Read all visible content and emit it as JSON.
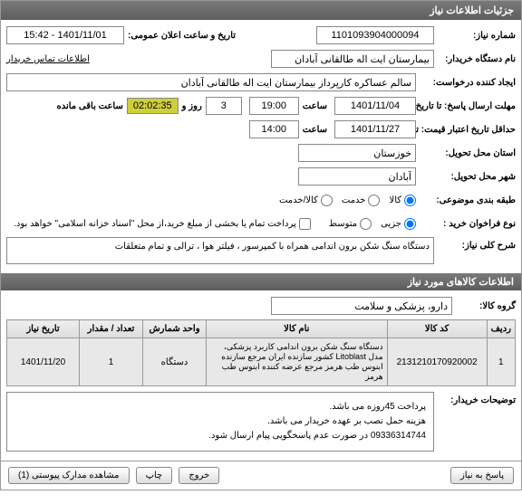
{
  "header": {
    "title": "جزئیات اطلاعات نیاز"
  },
  "fields": {
    "need_number": {
      "label": "شماره نیاز:",
      "value": "1101093904000094"
    },
    "announce": {
      "label": "تاریخ و ساعت اعلان عمومی:",
      "value": "1401/11/01 - 15:42"
    },
    "buyer_name": {
      "label": "نام دستگاه خریدار:",
      "value": "بیمارستان ایت اله طالقانی آبادان"
    },
    "buyer_contact_link": "اطلاعات تماس خریدار",
    "request_creator": {
      "label": "ایجاد کننده درخواست:",
      "value": "سالم عساکره کارپرداز بیمارستان ایت اله طالقانی آبادان"
    },
    "deadline": {
      "label": "مهلت ارسال پاسخ: تا تاریخ:",
      "date": "1401/11/04",
      "time_label": "ساعت",
      "time": "19:00",
      "days": "3",
      "days_label": "روز و",
      "timer": "02:02:35",
      "remaining": "ساعت باقی مانده"
    },
    "validity": {
      "label": "حداقل تاریخ اعتبار قیمت: تا",
      "date": "1401/11/27",
      "time_label": "ساعت",
      "time": "14:00"
    },
    "delivery_province": {
      "label": "استان محل تحویل:",
      "value": "خوزستان"
    },
    "delivery_city": {
      "label": "شهر محل تحویل:",
      "value": "آبادان"
    },
    "category": {
      "label": "طبقه بندی موضوعی:",
      "opts": [
        "کالا",
        "خدمت",
        "کالا/خدمت"
      ]
    },
    "purchase_type": {
      "label": "نوع فراخوان خرید :",
      "opts": [
        "جزیی",
        "متوسط",
        "پرداخت تمام یا بخشی از مبلغ خرید،از محل \"اسناد خزانه اسلامی\" خواهد بود."
      ]
    },
    "desc": {
      "label": "شرح کلی نیاز:",
      "value": "دستگاه سنگ شکن برون اندامی همراه با کمپرسور ، فیلتر هوا ، ترالی و تمام متعلقات"
    },
    "goods_section": "اطلاعات کالاهای مورد نیاز",
    "goods_group": {
      "label": "گروه کالا:",
      "value": "دارو، پزشکی و سلامت"
    }
  },
  "table": {
    "headers": [
      "ردیف",
      "کد کالا",
      "نام کالا",
      "واحد شمارش",
      "تعداد / مقدار",
      "تاریخ نیاز"
    ],
    "row": {
      "idx": "1",
      "code": "2131210170920002",
      "name": "دستگاه سنگ شکن برون اندامی کاربرد پزشکی، مدل Litoblast کشور سازنده ایران مرجع سازنده ابنوس طب هرمز مرجع عرضه کننده ابنوس طب هرمز",
      "unit": "دستگاه",
      "qty": "1",
      "date": "1401/11/20"
    }
  },
  "notes": {
    "label": "توضیحات خریدار:",
    "lines": [
      "پرداخت 45روزه می باشد.",
      "هزینه حمل  نصب بر عهده خریدار می باشد.",
      "09336314744 در صورت عدم پاسخگویی پیام ارسال شود."
    ]
  },
  "footer": {
    "btn_answer": "پاسخ به نیاز",
    "btn_attach": "مشاهده مدارک پیوستی (1)",
    "btn_print": "چاپ",
    "btn_exit": "خروج"
  }
}
